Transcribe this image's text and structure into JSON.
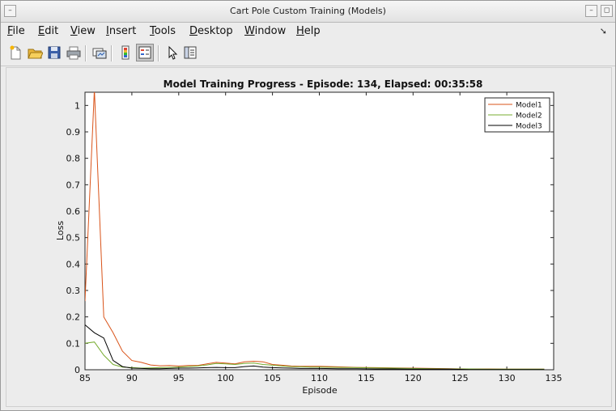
{
  "window": {
    "title": "Cart Pole Custom Training (Models)"
  },
  "menu": [
    {
      "label": "File",
      "ul": "F",
      "rest": "ile"
    },
    {
      "label": "Edit",
      "ul": "E",
      "rest": "dit"
    },
    {
      "label": "View",
      "ul": "V",
      "rest": "iew"
    },
    {
      "label": "Insert",
      "ul": "I",
      "rest": "nsert"
    },
    {
      "label": "Tools",
      "ul": "T",
      "rest": "ools"
    },
    {
      "label": "Desktop",
      "ul": "D",
      "rest": "esktop"
    },
    {
      "label": "Window",
      "ul": "W",
      "rest": "indow"
    },
    {
      "label": "Help",
      "ul": "H",
      "rest": "elp"
    }
  ],
  "toolbar": {
    "icons": [
      "new-figure-icon",
      "open-file-icon",
      "save-icon",
      "print-icon",
      "link-plot-icon",
      "colorbar-icon",
      "legend-icon",
      "pointer-icon",
      "property-editor-icon"
    ]
  },
  "chart_data": {
    "type": "line",
    "title": "Model Training Progress - Episode: 134, Elapsed: 00:35:58",
    "xlabel": "Episode",
    "ylabel": "Loss",
    "xlim": [
      85,
      135
    ],
    "ylim": [
      0,
      1.05
    ],
    "xticks": [
      85,
      90,
      95,
      100,
      105,
      110,
      115,
      120,
      125,
      130,
      135
    ],
    "yticks": [
      0,
      0.1,
      0.2,
      0.3,
      0.4,
      0.5,
      0.6,
      0.7,
      0.8,
      0.9,
      1
    ],
    "grid": false,
    "legend_position": "top-right",
    "x": [
      85,
      86,
      87,
      88,
      89,
      90,
      91,
      92,
      93,
      94,
      95,
      96,
      97,
      98,
      99,
      100,
      101,
      102,
      103,
      104,
      105,
      106,
      107,
      108,
      109,
      110,
      112,
      114,
      116,
      118,
      120,
      122,
      124,
      126,
      128,
      130,
      132,
      134
    ],
    "series": [
      {
        "name": "Model1",
        "color": "#d95319",
        "values": [
          0.26,
          1.06,
          0.2,
          0.14,
          0.07,
          0.035,
          0.028,
          0.018,
          0.015,
          0.016,
          0.014,
          0.016,
          0.016,
          0.022,
          0.028,
          0.025,
          0.022,
          0.03,
          0.032,
          0.03,
          0.02,
          0.017,
          0.014,
          0.013,
          0.013,
          0.013,
          0.011,
          0.009,
          0.008,
          0.007,
          0.006,
          0.005,
          0.004,
          0.003,
          0.003,
          0.002,
          0.002,
          0.002
        ]
      },
      {
        "name": "Model2",
        "color": "#77ac30",
        "values": [
          0.1,
          0.105,
          0.055,
          0.02,
          0.01,
          0.008,
          0.006,
          0.007,
          0.008,
          0.009,
          0.01,
          0.012,
          0.014,
          0.018,
          0.024,
          0.022,
          0.02,
          0.024,
          0.025,
          0.02,
          0.017,
          0.014,
          0.012,
          0.011,
          0.01,
          0.01,
          0.009,
          0.008,
          0.007,
          0.006,
          0.005,
          0.004,
          0.003,
          0.003,
          0.002,
          0.002,
          0.002,
          0.002
        ]
      },
      {
        "name": "Model3",
        "color": "#000000",
        "values": [
          0.17,
          0.14,
          0.12,
          0.035,
          0.012,
          0.006,
          0.005,
          0.004,
          0.004,
          0.005,
          0.006,
          0.006,
          0.007,
          0.008,
          0.009,
          0.008,
          0.008,
          0.012,
          0.014,
          0.01,
          0.008,
          0.007,
          0.006,
          0.005,
          0.005,
          0.005,
          0.004,
          0.004,
          0.003,
          0.003,
          0.002,
          0.002,
          0.002,
          0.001,
          0.001,
          0.001,
          0.001,
          0.001
        ]
      }
    ]
  }
}
